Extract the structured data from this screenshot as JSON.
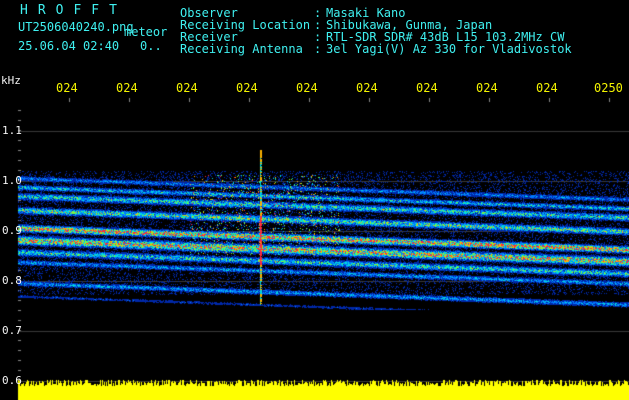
{
  "header": {
    "logo": "HROFFT",
    "filename": "UT2506040240.png",
    "meteor_label": "meteor",
    "datetime": "25.06.04 02:40",
    "count": "0..",
    "info": [
      {
        "label": "Observer",
        "value": "Masaki Kano"
      },
      {
        "label": "Receiving Location",
        "value": "Shibukawa, Gunma, Japan"
      },
      {
        "label": "Receiver",
        "value": "RTL-SDR SDR# 43dB L15 103.2MHz CW"
      },
      {
        "label": "Receiving Antenna",
        "value": "3el Yagi(V) Az 330 for Vladivostok"
      }
    ]
  },
  "axes": {
    "y_unit": "kHz",
    "y_ticks": [
      "1.1",
      "1.0",
      "0.9",
      "0.8",
      "0.7",
      "0.6"
    ],
    "x_ticks": [
      "024",
      "024",
      "024",
      "024",
      "024",
      "024",
      "024",
      "024",
      "024",
      "0250"
    ]
  },
  "colors": {
    "background": "#000000",
    "header_text": "#3ff0f0",
    "tick_text": "#f2f200",
    "signal": "#ffff00"
  }
}
